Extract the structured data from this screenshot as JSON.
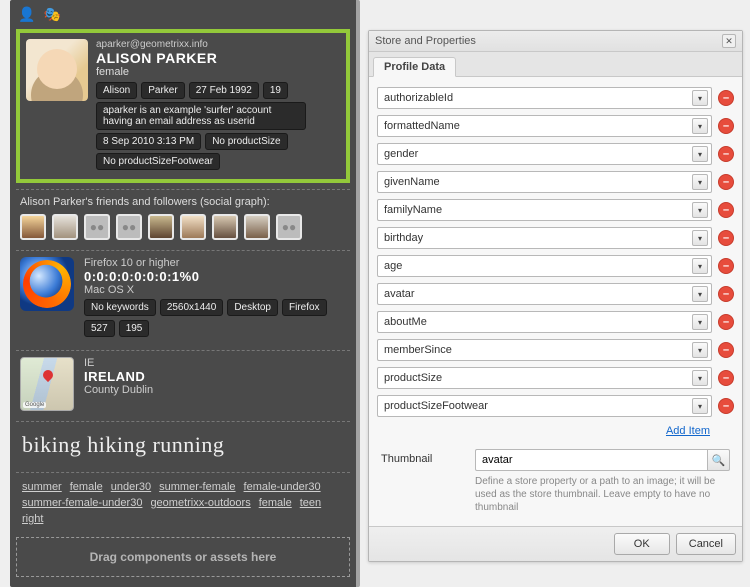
{
  "toolbar": {
    "user_icon": "user-icon",
    "mask_icon": "mask-icon"
  },
  "profile": {
    "email": "aparker@geometrixx.info",
    "name": "ALISON PARKER",
    "gender": "female",
    "chips_row1": [
      "Alison",
      "Parker",
      "27 Feb 1992",
      "19"
    ],
    "about": "aparker is an example 'surfer' account having an email address as userid",
    "chips_row2": [
      "8 Sep 2010 3:13 PM",
      "No productSize"
    ],
    "chips_row3": [
      "No productSizeFootwear"
    ]
  },
  "friends": {
    "label": "Alison Parker's friends and followers (social graph):"
  },
  "tech": {
    "title": "Firefox 10 or higher",
    "address": "0:0:0:0:0:0:0:1%0",
    "os": "Mac OS X",
    "chips": [
      "No keywords",
      "2560x1440",
      "Desktop",
      "Firefox",
      "527",
      "195"
    ]
  },
  "location": {
    "country_code": "IE",
    "country": "IRELAND",
    "region": "County Dublin",
    "map_brand": "Google"
  },
  "interests": {
    "big": "biking hiking running",
    "links": [
      "summer",
      "female",
      "under30",
      "summer-female",
      "female-under30",
      "summer-female-under30",
      "geometrixx-outdoors",
      "female",
      "teen",
      "right"
    ]
  },
  "dropzone": "Drag components or assets here",
  "dialog": {
    "title": "Store and Properties",
    "tab": "Profile Data",
    "fields": [
      "authorizableId",
      "formattedName",
      "gender",
      "givenName",
      "familyName",
      "birthday",
      "age",
      "avatar",
      "aboutMe",
      "memberSince",
      "productSize",
      "productSizeFootwear"
    ],
    "add_item": "Add Item",
    "thumbnail_label": "Thumbnail",
    "thumbnail_value": "avatar",
    "thumbnail_help": "Define a store property or a path to an image; it will be used as the store thumbnail. Leave empty to have no thumbnail",
    "ok": "OK",
    "cancel": "Cancel"
  }
}
